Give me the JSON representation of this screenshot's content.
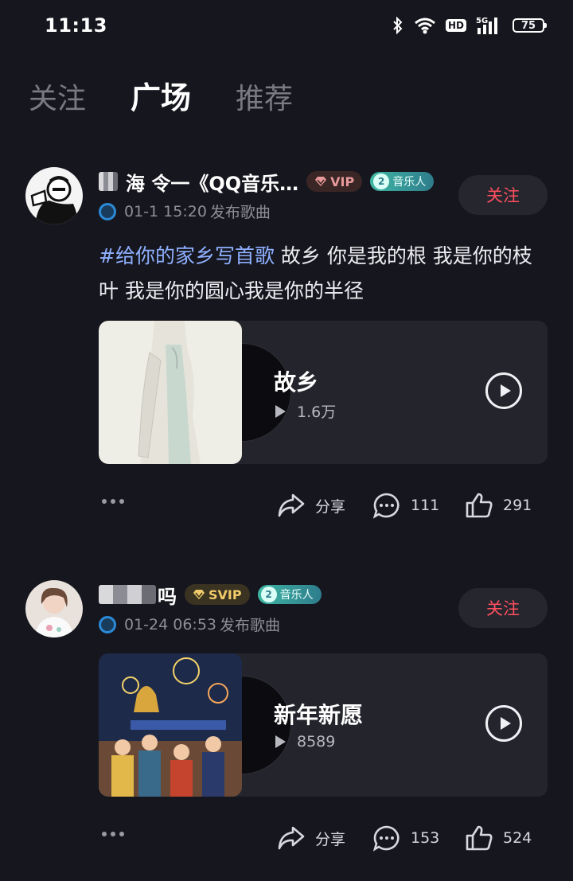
{
  "status_bar": {
    "time": "11:13",
    "hd": "HD",
    "network": "5G",
    "battery": "75"
  },
  "tabs": [
    {
      "label": "关注",
      "active": false
    },
    {
      "label": "广场",
      "active": true
    },
    {
      "label": "推荐",
      "active": false
    }
  ],
  "posts": [
    {
      "username_visible": "海 令一《QQ音乐…",
      "vip_badge": "VIP",
      "musician_level": "2",
      "musician_label": "音乐人",
      "time": "01-1 15:20",
      "action": "发布歌曲",
      "follow_label": "关注",
      "hashtag": "#给你的家乡写首歌",
      "text": " 故乡 你是我的根 我是你的枝叶  我是你的圆心我是你的半径",
      "song": {
        "title": "故乡",
        "plays": "1.6万"
      },
      "share_label": "分享",
      "comments": "111",
      "likes": "291",
      "colors": {
        "cover_bg": "#efeee6",
        "figure": "#c9d8cf"
      }
    },
    {
      "username_visible": "吗",
      "vip_badge": "SVIP",
      "musician_level": "2",
      "musician_label": "音乐人",
      "time": "01-24 06:53",
      "action": "发布歌曲",
      "follow_label": "关注",
      "song": {
        "title": "新年新愿",
        "plays": "8589"
      },
      "share_label": "分享",
      "comments": "153",
      "likes": "524"
    }
  ]
}
